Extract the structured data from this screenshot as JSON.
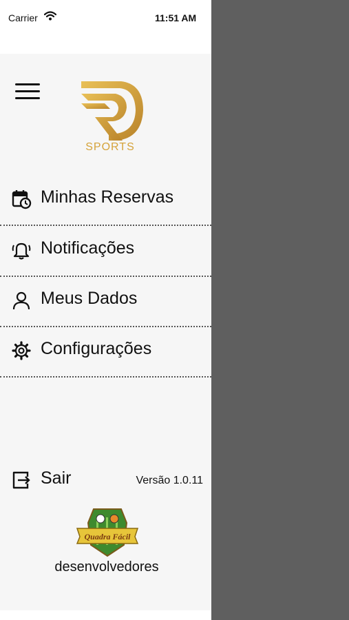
{
  "status_bar": {
    "carrier": "Carrier",
    "time": "11:51 AM"
  },
  "logo": {
    "text": "SPORTS",
    "gold": "#d5a33a"
  },
  "menu": [
    {
      "label": "Minhas Reservas",
      "icon": "calendar-clock-icon"
    },
    {
      "label": "Notificações",
      "icon": "bell-icon"
    },
    {
      "label": "Meus Dados",
      "icon": "user-icon"
    },
    {
      "label": "Configurações",
      "icon": "gear-icon"
    }
  ],
  "footer": {
    "logout_label": "Sair",
    "logout_icon": "logout-icon",
    "version": "Versão 1.0.11",
    "badge_text": "Quadra Fácil",
    "developers": "desenvolvedores"
  },
  "colors": {
    "drawer_bg": "#f6f6f6",
    "overlay": "#5f5f5f",
    "gold": "#d5a33a"
  }
}
